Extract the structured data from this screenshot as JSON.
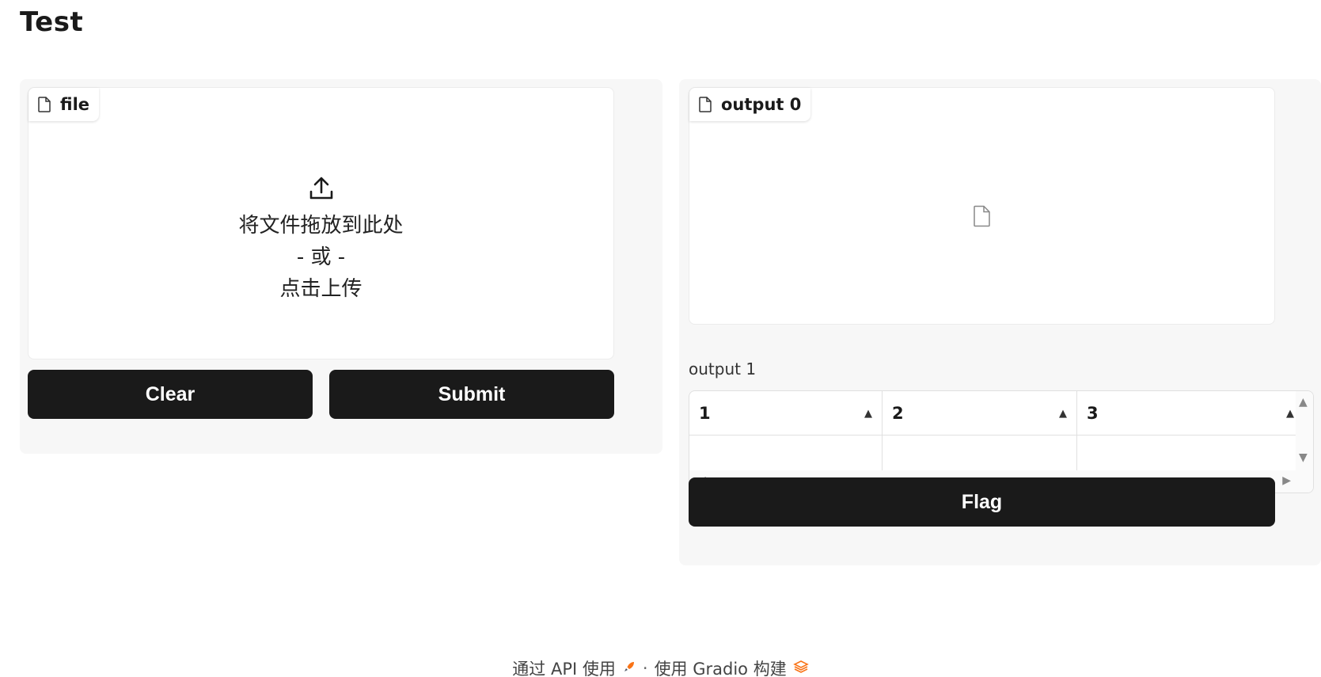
{
  "app": {
    "title": "Test"
  },
  "input": {
    "label": "file",
    "drop_text": "将文件拖放到此处",
    "or_text": "- 或 -",
    "click_text": "点击上传",
    "upload_icon": "upload-icon"
  },
  "buttons": {
    "clear": "Clear",
    "submit": "Submit",
    "flag": "Flag"
  },
  "output0": {
    "label": "output 0",
    "empty_icon": "file-icon"
  },
  "output1": {
    "label": "output 1",
    "columns": [
      "1",
      "2",
      "3"
    ],
    "rows": [
      [
        "",
        "",
        ""
      ]
    ]
  },
  "footer": {
    "api_text": "通过 API 使用",
    "separator": "·",
    "built_text": "使用 Gradio 构建",
    "api_icon": "rocket-icon",
    "gradio_icon": "gradio-logo-icon",
    "accent": "#f97316"
  }
}
